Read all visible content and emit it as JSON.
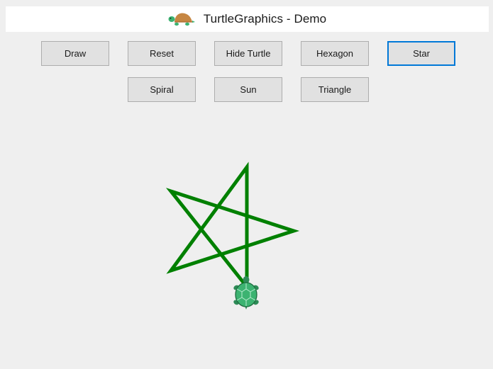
{
  "window": {
    "title": "TurtleGraphics - Demo",
    "icon": "turtle-icon"
  },
  "toolbar": {
    "buttons": [
      {
        "label": "Draw",
        "focused": false
      },
      {
        "label": "Reset",
        "focused": false
      },
      {
        "label": "Hide Turtle",
        "focused": false
      },
      {
        "label": "Hexagon",
        "focused": false
      },
      {
        "label": "Star",
        "focused": true
      },
      {
        "label": "Spiral",
        "focused": false
      },
      {
        "label": "Sun",
        "focused": false
      },
      {
        "label": "Triangle",
        "focused": false
      }
    ]
  },
  "canvas": {
    "drawing": "star",
    "pen_color": "#008000",
    "turtle_color": "#3cb371",
    "turtle_visible": true
  }
}
